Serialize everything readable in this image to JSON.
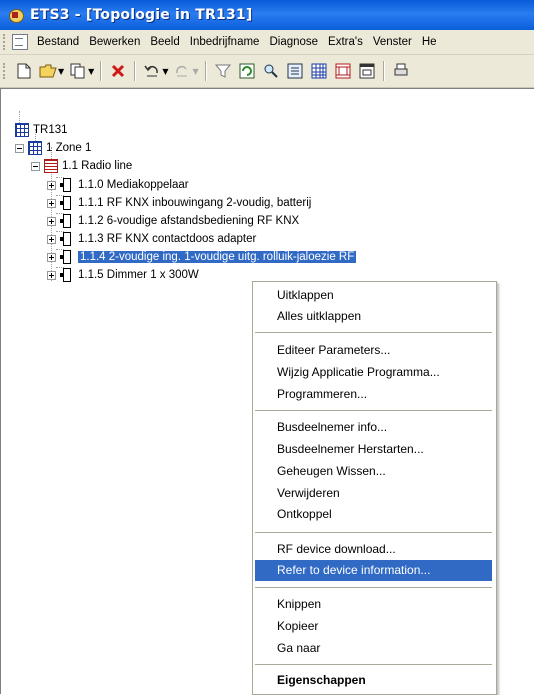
{
  "window": {
    "title": "ETS3 - [Topologie in TR131]"
  },
  "menubar": {
    "items": [
      {
        "label": "Bestand"
      },
      {
        "label": "Bewerken"
      },
      {
        "label": "Beeld"
      },
      {
        "label": "Inbedrijfname"
      },
      {
        "label": "Diagnose"
      },
      {
        "label": "Extra's"
      },
      {
        "label": "Venster"
      },
      {
        "label": "He"
      }
    ]
  },
  "toolbar": {
    "icons": [
      "new-icon",
      "open-icon",
      "copy-icon",
      "delete-icon",
      "undo-icon",
      "redo-icon",
      "filter-icon",
      "refresh-icon",
      "search-icon",
      "properties-icon",
      "grid-icon",
      "component-icon",
      "window-icon",
      "print-icon"
    ]
  },
  "tree": {
    "root": "TR131",
    "zone": "1 Zone 1",
    "line": "1.1 Radio line",
    "devices": [
      "1.1.0 Mediakoppelaar",
      "1.1.1 RF KNX inbouwingang 2-voudig, batterij",
      "1.1.2 6-voudige afstandsbediening RF KNX",
      "1.1.3 RF KNX contactdoos adapter",
      "1.1.4 2-voudige ing. 1-voudige uitg. rolluik-jaloezie RF",
      "1.1.5 Dimmer 1 x 300W"
    ],
    "selected_index": 4
  },
  "context_menu": {
    "groups": [
      [
        "Uitklappen",
        "Alles uitklappen"
      ],
      [
        "Editeer Parameters...",
        "Wijzig Applicatie Programma...",
        "Programmeren..."
      ],
      [
        "Busdeelnemer info...",
        "Busdeelnemer Herstarten...",
        "Geheugen Wissen...",
        "Verwijderen",
        "Ontkoppel"
      ],
      [
        "RF device download...",
        "Refer to device information..."
      ],
      [
        "Knippen",
        "Kopieer",
        "Ga naar"
      ],
      [
        "Eigenschappen"
      ]
    ],
    "highlighted": "Refer to device information...",
    "bold": "Eigenschappen"
  },
  "colors": {
    "titlebar": "#0a5bd8",
    "selection": "#316ac5",
    "menu_bg": "#ece9d8"
  }
}
